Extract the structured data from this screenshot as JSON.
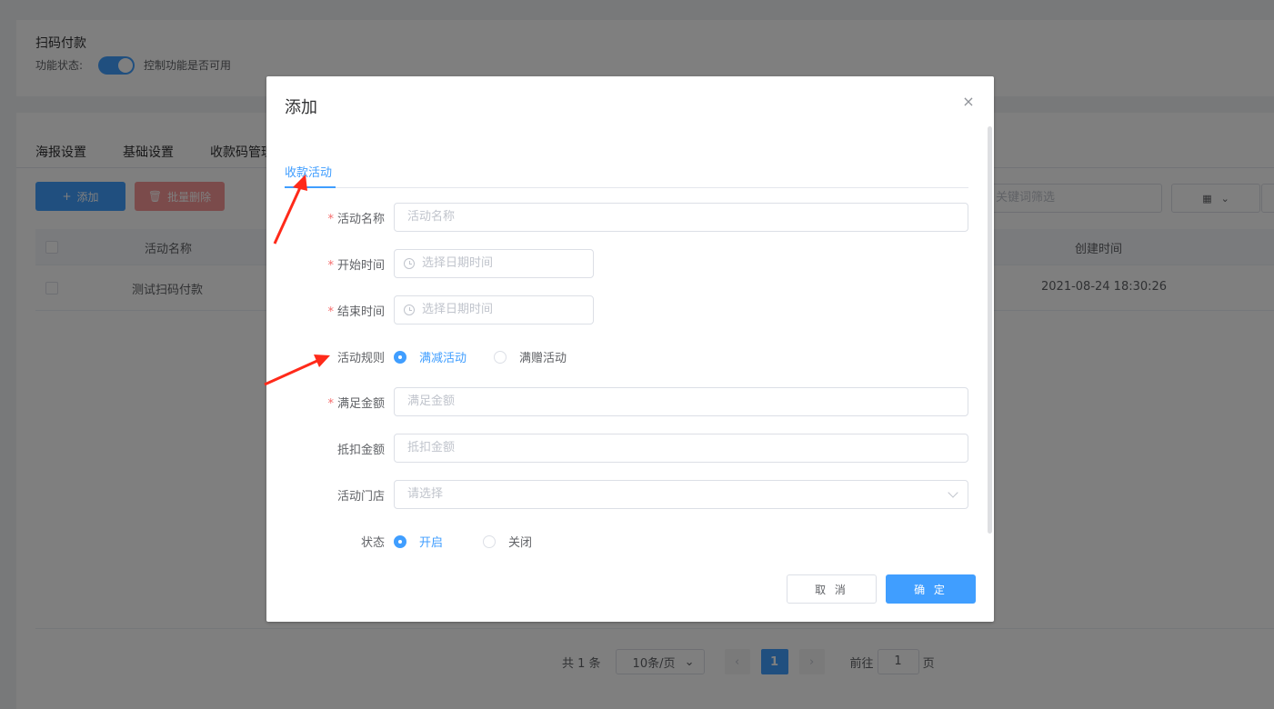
{
  "page": {
    "header_title": "扫码付款",
    "status_label": "功能状态:",
    "switch_text": "控制功能是否可用",
    "tabs": [
      "海报设置",
      "基础设置",
      "收款码管理"
    ],
    "add_label": "添加",
    "batch_delete_label": "批量删除",
    "search_placeholder": "关键词筛选",
    "table": {
      "columns": [
        "活动名称",
        "创建时间"
      ],
      "rows": [
        {
          "name": "测试扫码付款",
          "created": "2021-08-24 18:30:26"
        }
      ]
    },
    "pagination": {
      "total": "共 1 条",
      "page_size": "10条/页",
      "current_page": "1",
      "goto_prefix": "前往",
      "goto_value": "1",
      "goto_suffix": "页"
    }
  },
  "dialog": {
    "title": "添加",
    "tab": "收款活动",
    "fields": {
      "name": {
        "label": "活动名称",
        "placeholder": "活动名称",
        "required": true
      },
      "start": {
        "label": "开始时间",
        "placeholder": "选择日期时间",
        "required": true
      },
      "end": {
        "label": "结束时间",
        "placeholder": "选择日期时间",
        "required": true
      },
      "rule": {
        "label": "活动规则",
        "options": [
          "满减活动",
          "满赠活动"
        ],
        "selected": "满减活动"
      },
      "threshold": {
        "label": "满足金额",
        "placeholder": "满足金额",
        "required": true
      },
      "discount": {
        "label": "抵扣金额",
        "placeholder": "抵扣金额"
      },
      "store": {
        "label": "活动门店",
        "placeholder": "请选择"
      },
      "state": {
        "label": "状态",
        "options": [
          "开启",
          "关闭"
        ],
        "selected": "开启"
      }
    },
    "required_mark": "*",
    "cancel_label": "取 消",
    "ok_label": "确 定",
    "close_icon": "×"
  },
  "colors": {
    "primary": "#409eff",
    "danger": "#f56c6c",
    "annotation_arrow": "#ff2a1a"
  }
}
